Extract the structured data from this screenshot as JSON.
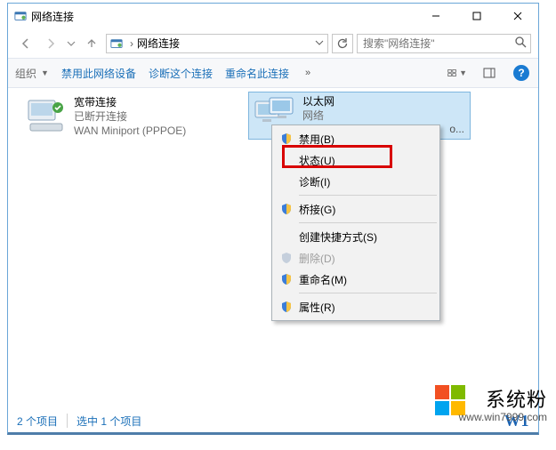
{
  "window": {
    "title": "网络连接"
  },
  "addressbar": {
    "crumb1": "网络连接"
  },
  "search": {
    "placeholder": "搜索\"网络连接\""
  },
  "commands": {
    "organize": "组织",
    "disable": "禁用此网络设备",
    "diagnose": "诊断这个连接",
    "rename": "重命名此连接",
    "overflow": "»"
  },
  "connections": {
    "broadband": {
      "name": "宽带连接",
      "state": "已断开连接",
      "device": "WAN Miniport (PPPOE)"
    },
    "ethernet": {
      "name": "以太网",
      "state": "网络",
      "device_end": "o..."
    }
  },
  "context_menu": {
    "disable": "禁用(B)",
    "status": "状态(U)",
    "diagnose": "诊断(I)",
    "bridge": "桥接(G)",
    "shortcut": "创建快捷方式(S)",
    "delete": "删除(D)",
    "rename": "重命名(M)",
    "properties": "属性(R)"
  },
  "statusbar": {
    "count": "2 个项目",
    "selected": "选中 1 个项目",
    "tail": "W1"
  },
  "watermark": {
    "brand": "系统粉",
    "url": "www.win7999.com"
  },
  "colors": {
    "ms_red": "#f25022",
    "ms_green": "#7fba00",
    "ms_blue": "#00a4ef",
    "ms_yellow": "#ffb900"
  }
}
